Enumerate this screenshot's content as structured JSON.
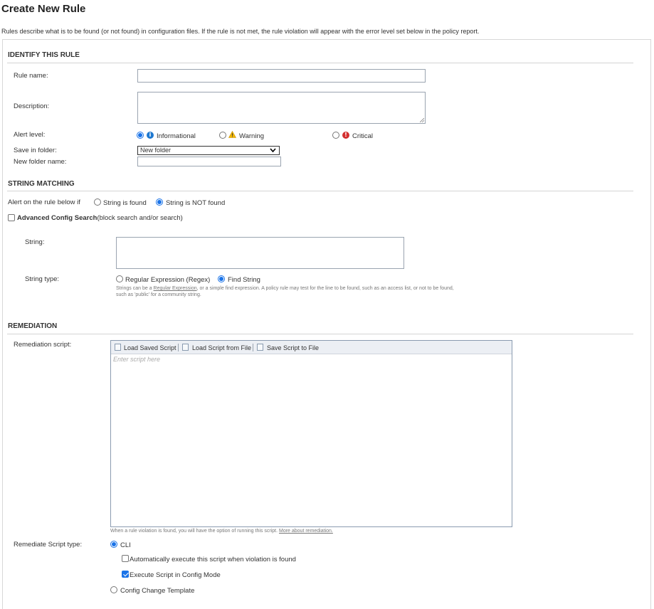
{
  "page": {
    "title": "Create New Rule",
    "intro": "Rules describe what is to be found (or not found) in configuration files. If the rule is not met, the rule violation will appear with the error level set below in the policy report."
  },
  "identify": {
    "heading": "IDENTIFY THIS RULE",
    "rule_name_label": "Rule name:",
    "rule_name_value": "",
    "description_label": "Description:",
    "description_value": "",
    "alert_level_label": "Alert level:",
    "alert_levels": [
      {
        "label": "Informational",
        "icon": "info-icon",
        "selected": true
      },
      {
        "label": "Warning",
        "icon": "warning-icon",
        "selected": false
      },
      {
        "label": "Critical",
        "icon": "critical-icon",
        "selected": false
      }
    ],
    "save_in_folder_label": "Save in folder:",
    "save_in_folder_value": "New folder",
    "new_folder_name_label": "New folder name:",
    "new_folder_name_value": ""
  },
  "string_matching": {
    "heading": "STRING MATCHING",
    "alert_on_label": "Alert on the rule below if",
    "option_found": "String is found",
    "option_not_found": "String is NOT found",
    "selected": "not_found",
    "advanced_label": "Advanced Config Search",
    "advanced_suffix": "(block search and/or search)",
    "advanced_checked": false,
    "string_label": "String:",
    "string_value": "",
    "string_type_label": "String type:",
    "type_regex": "Regular Expression (Regex)",
    "type_find": "Find String",
    "type_selected": "find",
    "help_pre": "Strings can be a ",
    "help_link": "Regular Expression",
    "help_post": ", or a simple find expression. A policy rule may test for the line to be found, such as an access list, or not to be found,",
    "help_line2": "such as 'public' for a community string."
  },
  "remediation": {
    "heading": "REMEDIATION",
    "script_label": "Remediation script:",
    "toolbar": {
      "load_saved": "Load Saved Script",
      "load_file": "Load Script from File",
      "save_file": "Save Script to File"
    },
    "script_placeholder": "Enter script here",
    "note": "When a rule violation is found, you will have the option of running this script.",
    "note_link": "More about remediation.",
    "script_type_label": "Remediate Script type:",
    "type_cli": "CLI",
    "cli_selected": true,
    "auto_execute": "Automatically execute this script when violation is found",
    "auto_execute_checked": false,
    "config_mode": "Execute Script in Config Mode",
    "config_mode_checked": true,
    "type_template": "Config Change Template"
  },
  "colors": {
    "accent": "#1a73e8",
    "info": "#1e78d0",
    "warning": "#f2b705",
    "critical": "#d32f2f"
  }
}
